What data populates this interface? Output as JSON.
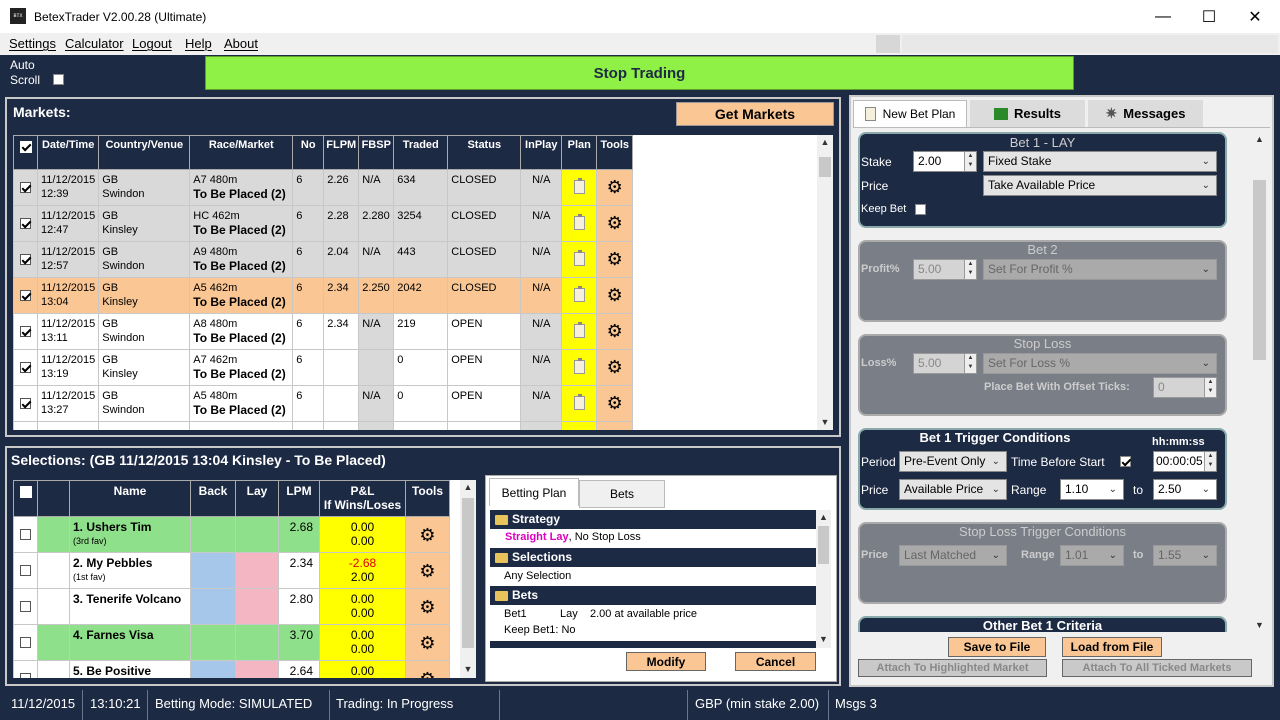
{
  "window": {
    "title": "BetexTrader V2.00.28 (Ultimate)",
    "icon_label": "BTX",
    "minimize": "—",
    "maximize": "☐",
    "close": "✕"
  },
  "menu": [
    "Settings",
    "Calculator",
    "Logout",
    "Help",
    "About"
  ],
  "toolbar": {
    "auto_label": "Auto",
    "scroll_label": "Scroll",
    "stop_trading": "Stop Trading"
  },
  "markets": {
    "title": "Markets:",
    "get_markets": "Get Markets",
    "columns": [
      "Date/Time",
      "Country/Venue",
      "Race/Market",
      "No",
      "FLPM",
      "FBSP",
      "Traded",
      "Status",
      "InPlay",
      "Plan",
      "Tools"
    ],
    "rows": [
      {
        "date": "11/12/2015",
        "time": "12:39",
        "country": "GB",
        "venue": "Swindon",
        "race": "A7 480m",
        "market": "To Be Placed (2)",
        "no": "6",
        "flpm": "2.26",
        "fbsp": "N/A",
        "traded": "634",
        "status": "CLOSED",
        "inplay": "N/A"
      },
      {
        "date": "11/12/2015",
        "time": "12:47",
        "country": "GB",
        "venue": "Kinsley",
        "race": "HC 462m",
        "market": "To Be Placed (2)",
        "no": "6",
        "flpm": "2.28",
        "fbsp": "2.280",
        "traded": "3254",
        "status": "CLOSED",
        "inplay": "N/A"
      },
      {
        "date": "11/12/2015",
        "time": "12:57",
        "country": "GB",
        "venue": "Swindon",
        "race": "A9 480m",
        "market": "To Be Placed (2)",
        "no": "6",
        "flpm": "2.04",
        "fbsp": "N/A",
        "traded": "443",
        "status": "CLOSED",
        "inplay": "N/A"
      },
      {
        "date": "11/12/2015",
        "time": "13:04",
        "country": "GB",
        "venue": "Kinsley",
        "race": "A5 462m",
        "market": "To Be Placed (2)",
        "no": "6",
        "flpm": "2.34",
        "fbsp": "2.250",
        "traded": "2042",
        "status": "CLOSED",
        "inplay": "N/A"
      },
      {
        "date": "11/12/2015",
        "time": "13:11",
        "country": "GB",
        "venue": "Swindon",
        "race": "A8 480m",
        "market": "To Be Placed (2)",
        "no": "6",
        "flpm": "2.34",
        "fbsp": "N/A",
        "traded": "219",
        "status": "OPEN",
        "inplay": "N/A"
      },
      {
        "date": "11/12/2015",
        "time": "13:19",
        "country": "GB",
        "venue": "Kinsley",
        "race": "A7 462m",
        "market": "To Be Placed (2)",
        "no": "6",
        "flpm": "",
        "fbsp": "",
        "traded": "0",
        "status": "OPEN",
        "inplay": "N/A"
      },
      {
        "date": "11/12/2015",
        "time": "13:27",
        "country": "GB",
        "venue": "Swindon",
        "race": "A5 480m",
        "market": "To Be Placed (2)",
        "no": "6",
        "flpm": "",
        "fbsp": "N/A",
        "traded": "0",
        "status": "OPEN",
        "inplay": "N/A"
      }
    ]
  },
  "selections": {
    "title": "Selections:  (GB 11/12/2015 13:04 Kinsley - To Be Placed)",
    "columns": [
      "Name",
      "Back",
      "Lay",
      "LPM",
      "P&L",
      "If Wins/Loses",
      "Tools"
    ],
    "rows": [
      {
        "name": "1. Ushers Tim",
        "sub": "(3rd fav)",
        "lpm": "2.68",
        "pl1": "0.00",
        "pl2": "0.00"
      },
      {
        "name": "2. My Pebbles",
        "sub": "(1st fav)",
        "lpm": "2.34",
        "pl1": "-2.68",
        "pl2": "2.00"
      },
      {
        "name": "3. Tenerife Volcano",
        "sub": "",
        "lpm": "2.80",
        "pl1": "0.00",
        "pl2": "0.00"
      },
      {
        "name": "4. Farnes Visa",
        "sub": "",
        "lpm": "3.70",
        "pl1": "0.00",
        "pl2": "0.00"
      },
      {
        "name": "5. Be Positive",
        "sub": "",
        "lpm": "2.64",
        "pl1": "0.00",
        "pl2": ""
      }
    ]
  },
  "betting_plan": {
    "tabs": [
      "Betting Plan",
      "Bets"
    ],
    "strategy_hdr": "Strategy",
    "strategy_type": "Straight Lay",
    "strategy_rest": ", No Stop Loss",
    "selections_hdr": "Selections",
    "selections_val": "Any Selection",
    "bets_hdr": "Bets",
    "bet1_a": "Bet1",
    "bet1_b": "Lay",
    "bet1_c": "2.00 at available price",
    "keep_bet": "Keep Bet1: No",
    "modify": "Modify",
    "cancel": "Cancel"
  },
  "right": {
    "tabs": [
      "New Bet Plan",
      "Results",
      "Messages"
    ],
    "bet1": {
      "title": "Bet 1 - LAY",
      "stake_label": "Stake",
      "stake": "2.00",
      "stake_type": "Fixed Stake",
      "price_label": "Price",
      "price_type": "Take Available Price",
      "keep_bet": "Keep Bet"
    },
    "bet2": {
      "title": "Bet 2",
      "profit_label": "Profit%",
      "profit": "5.00",
      "profit_type": "Set For Profit %"
    },
    "stoploss": {
      "title": "Stop Loss",
      "loss_label": "Loss%",
      "loss": "5.00",
      "loss_type": "Set For Loss %",
      "offset_label": "Place Bet With Offset Ticks:",
      "offset": "0"
    },
    "trigger": {
      "title": "Bet 1 Trigger Conditions",
      "hms": "hh:mm:ss",
      "period_label": "Period",
      "period": "Pre-Event Only",
      "tbs_label": "Time Before Start",
      "time": "00:00:05",
      "price_label": "Price",
      "price": "Available Price",
      "range_label": "Range",
      "range_from": "1.10",
      "to": "to",
      "range_to": "2.50"
    },
    "sl_trigger": {
      "title": "Stop Loss Trigger Conditions",
      "price_label": "Price",
      "price": "Last Matched",
      "range_label": "Range",
      "range_from": "1.01",
      "to": "to",
      "range_to": "1.55"
    },
    "other": {
      "title": "Other Bet 1 Criteria"
    },
    "save": "Save to File",
    "load": "Load from File",
    "attach_hl": "Attach To Highlighted Market",
    "attach_all": "Attach To All Ticked Markets"
  },
  "status": {
    "date": "11/12/2015",
    "time": "13:10:21",
    "mode": "Betting Mode: SIMULATED",
    "trading": "Trading: In Progress",
    "currency": "GBP (min stake 2.00)",
    "msgs": "Msgs 3"
  },
  "colors": {
    "navy": "#1d2a44",
    "green": "#8ff046",
    "orange": "#f9c694",
    "yellow": "#ffff00",
    "grayrow": "#d9d9d9",
    "back": "#a7c7ea",
    "lay": "#f4b6c2",
    "sel_green": "#8fe08a"
  }
}
